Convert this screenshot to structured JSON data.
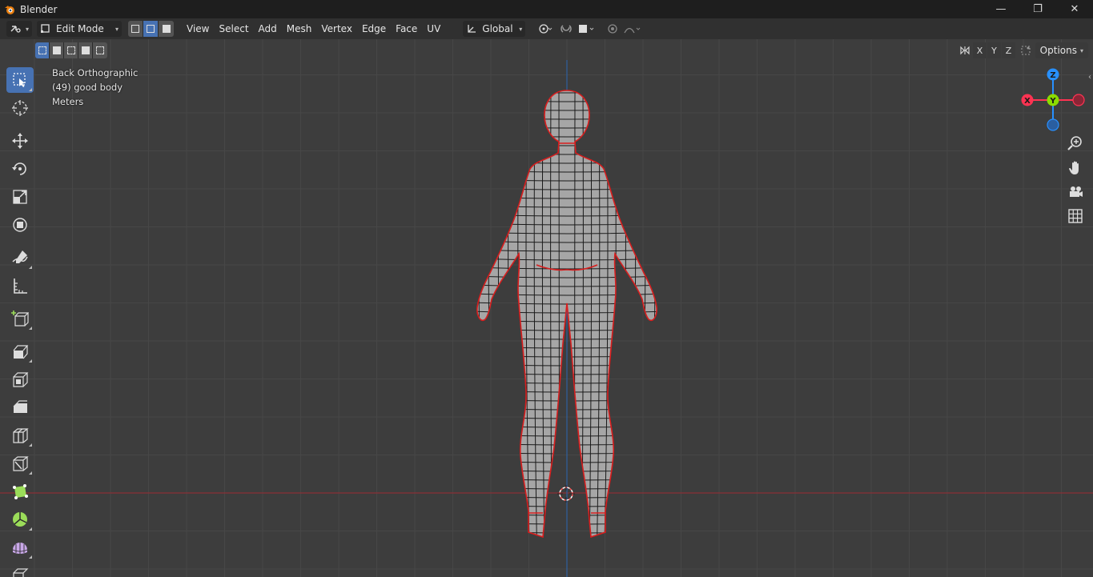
{
  "window": {
    "title": "Blender",
    "minimize": "—",
    "maximize": "❐",
    "close": "✕"
  },
  "header": {
    "mode": "Edit Mode",
    "menus": [
      "View",
      "Select",
      "Add",
      "Mesh",
      "Vertex",
      "Edge",
      "Face",
      "UV"
    ],
    "transform_orientation": "Global"
  },
  "subbar": {
    "axis_x": "X",
    "axis_y": "Y",
    "axis_z": "Z",
    "options_label": "Options"
  },
  "viewport_info": {
    "view": "Back Orthographic",
    "object": "(49) good body",
    "units": "Meters"
  },
  "gizmo": {
    "z": "Z",
    "y": "Y",
    "x": "X"
  },
  "colors": {
    "active_blue": "#4772b3",
    "x_axis": "#ff3352",
    "y_axis": "#8bdc00",
    "z_axis": "#2890ff",
    "viewport_bg": "#3d3d3d",
    "header_bg": "#303030"
  },
  "tools": [
    "select-box-icon",
    "cursor-icon",
    "move-icon",
    "rotate-icon",
    "scale-icon",
    "transform-icon",
    "annotate-icon",
    "measure-icon",
    "add-cube-icon",
    "extrude-icon",
    "inset-icon",
    "bevel-icon",
    "loop-cut-icon",
    "knife-icon",
    "poly-build-icon",
    "spin-icon",
    "smooth-icon",
    "shear-icon"
  ]
}
